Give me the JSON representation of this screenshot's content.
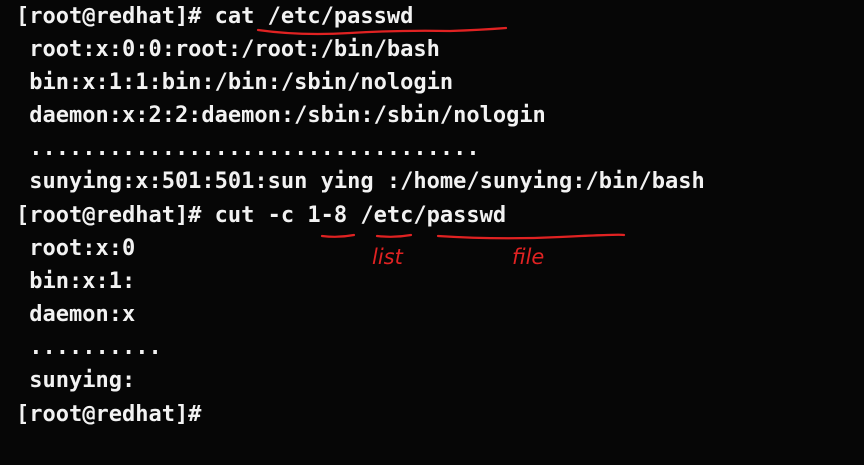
{
  "terminal": {
    "lines": [
      "[root@redhat]# cat /etc/passwd",
      " root:x:0:0:root:/root:/bin/bash",
      " bin:x:1:1:bin:/bin:/sbin/nologin",
      " daemon:x:2:2:daemon:/sbin:/sbin/nologin",
      " ..................................",
      " sunying:x:501:501:sun ying :/home/sunying:/bin/bash",
      "[root@redhat]# cut -c 1-8 /etc/passwd",
      " root:x:0",
      " bin:x:1:",
      " daemon:x",
      " ..........",
      " sunying:",
      "[root@redhat]# "
    ]
  },
  "annotations": {
    "list_label": "list",
    "file_label": "file",
    "color": "#e02222"
  }
}
